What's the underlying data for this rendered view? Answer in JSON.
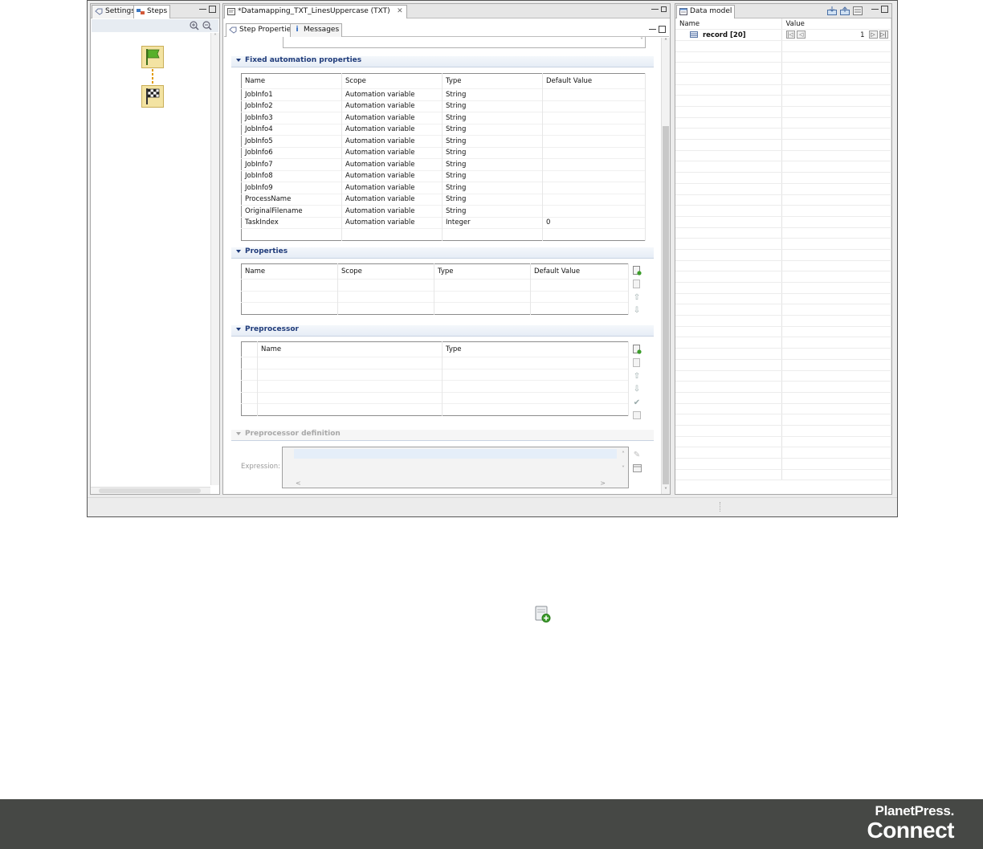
{
  "left_panel": {
    "tabs": [
      "Settings",
      "Steps"
    ]
  },
  "editor": {
    "file_tab": "*Datamapping_TXT_LinesUppercase (TXT)",
    "subtabs": [
      "Step Properties",
      "Messages"
    ],
    "fixed_section": {
      "title": "Fixed automation properties",
      "columns": [
        "Name",
        "Scope",
        "Type",
        "Default Value"
      ],
      "rows": [
        [
          "JobInfo1",
          "Automation variable",
          "String",
          ""
        ],
        [
          "JobInfo2",
          "Automation variable",
          "String",
          ""
        ],
        [
          "JobInfo3",
          "Automation variable",
          "String",
          ""
        ],
        [
          "JobInfo4",
          "Automation variable",
          "String",
          ""
        ],
        [
          "JobInfo5",
          "Automation variable",
          "String",
          ""
        ],
        [
          "JobInfo6",
          "Automation variable",
          "String",
          ""
        ],
        [
          "JobInfo7",
          "Automation variable",
          "String",
          ""
        ],
        [
          "JobInfo8",
          "Automation variable",
          "String",
          ""
        ],
        [
          "JobInfo9",
          "Automation variable",
          "String",
          ""
        ],
        [
          "ProcessName",
          "Automation variable",
          "String",
          ""
        ],
        [
          "OriginalFilename",
          "Automation variable",
          "String",
          ""
        ],
        [
          "TaskIndex",
          "Automation variable",
          "Integer",
          "0"
        ]
      ]
    },
    "properties_section": {
      "title": "Properties",
      "columns": [
        "Name",
        "Scope",
        "Type",
        "Default Value"
      ]
    },
    "preprocessor_section": {
      "title": "Preprocessor",
      "columns": [
        "Name",
        "Type"
      ]
    },
    "preprocessor_definition": {
      "title": "Preprocessor definition",
      "expression_label": "Expression:"
    }
  },
  "data_model": {
    "tab": "Data model",
    "columns": [
      "Name",
      "Value"
    ],
    "record_label": "record [20]",
    "record_index": "1"
  },
  "footer": {
    "brand_line1": "PlanetPress.",
    "brand_line2": "Connect"
  }
}
